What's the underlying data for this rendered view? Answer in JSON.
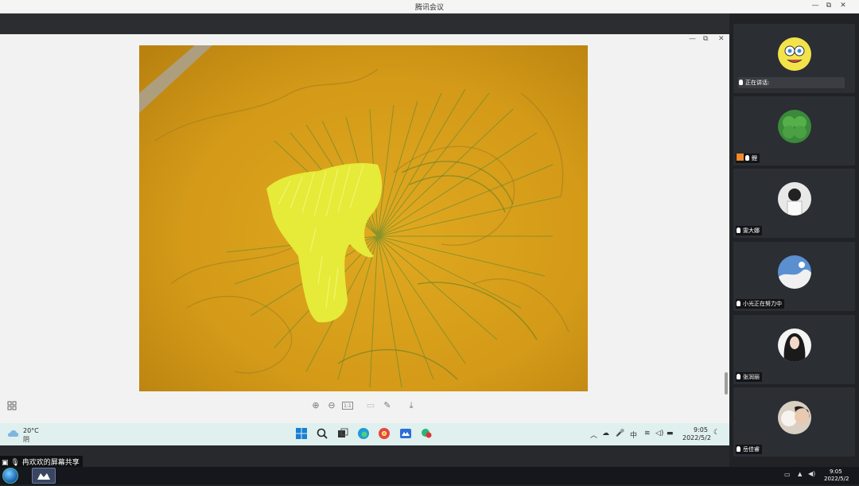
{
  "window": {
    "title": "腾讯会议"
  },
  "viewer": {
    "controls": [
      "—",
      "⧉",
      "✕"
    ],
    "toolbar": [
      "zoom-in",
      "zoom-out",
      "actual-size",
      "crop",
      "edit",
      "save"
    ],
    "toolbar_glyphs": {
      "actual": "1:1"
    }
  },
  "share_label": "冉欢欢的屏幕共享",
  "inner_taskbar": {
    "weather_temp": "20°C",
    "weather_desc": "阴",
    "ime": "中",
    "time": "9:05",
    "date": "2022/5/2"
  },
  "participants": [
    {
      "name": "正在讲话:",
      "role": "speaking"
    },
    {
      "name": "鲤"
    },
    {
      "name": "雯大娜"
    },
    {
      "name": "小光正在努力中"
    },
    {
      "name": "张润丽"
    },
    {
      "name": "岳佳睿"
    }
  ],
  "outer_taskbar": {
    "time": "9:05",
    "date": "2022/5/2"
  },
  "colors": {
    "fabric": "#d9a21c",
    "thread_yellow": "#e8ec3a",
    "thread_green": "#6f8a2a"
  }
}
